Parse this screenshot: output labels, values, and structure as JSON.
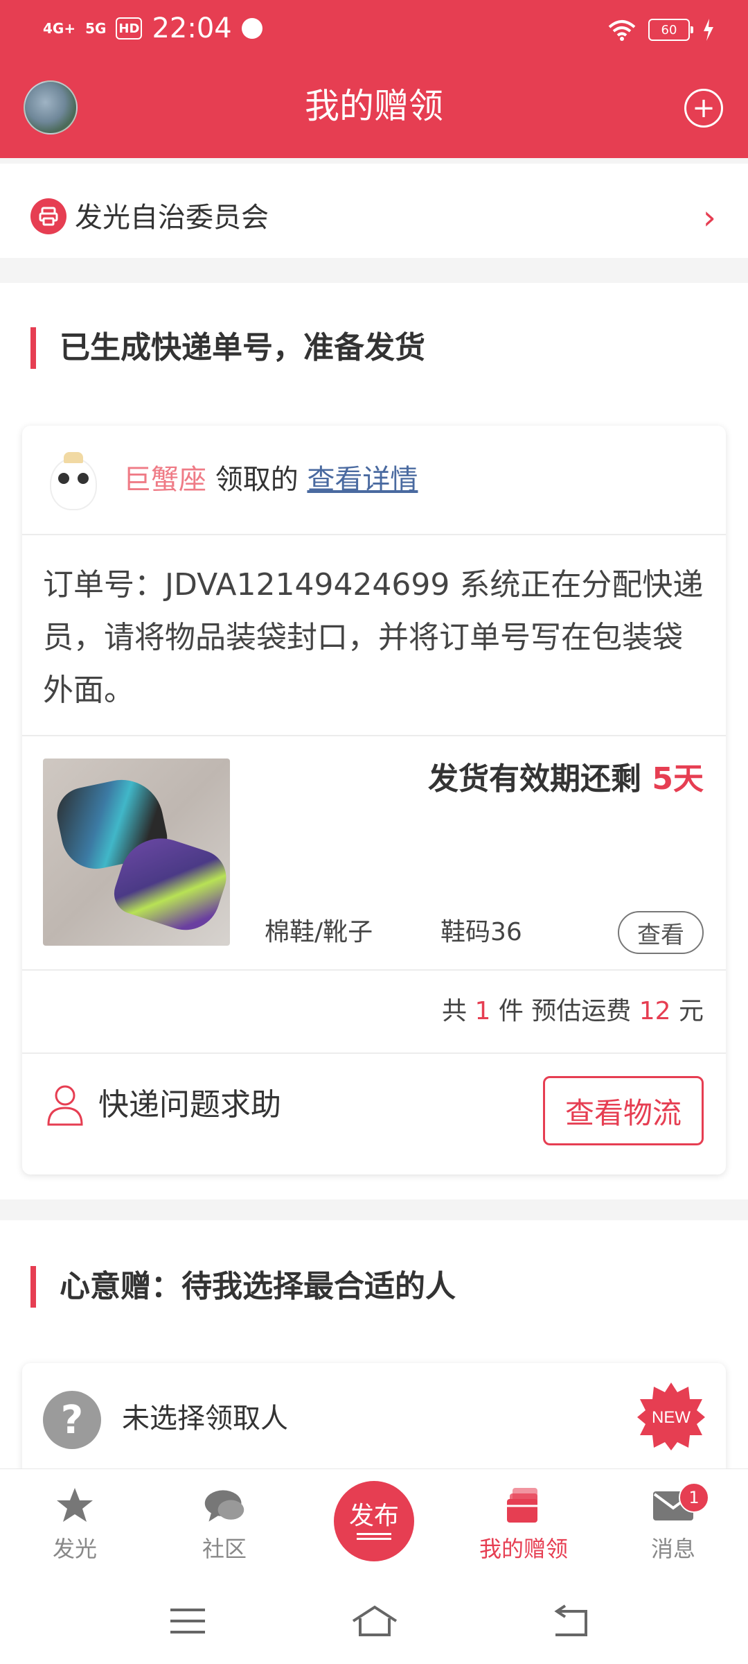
{
  "status_bar": {
    "signal1": "4G+",
    "signal2": "5G",
    "hd": "HD",
    "time": "22:04",
    "battery": "60"
  },
  "header": {
    "title": "我的赠领"
  },
  "group": {
    "name": "发光自治委员会"
  },
  "section_shipping": {
    "title": "已生成快递单号，准备发货",
    "claimer_name": "巨蟹座",
    "claimer_text": "领取的",
    "detail_link": "查看详情",
    "order_message": "订单号：JDVA12149424699 系统正在分配快递员，请将物品装袋封口，并将订单号写在包装袋外面。",
    "validity_prefix": "发货有效期还剩",
    "validity_days": "5天",
    "item_category": "棉鞋/靴子",
    "item_size": "鞋码36",
    "view_button": "查看",
    "summary_prefix": "共",
    "summary_count": "1",
    "summary_mid": "件 预估运费",
    "summary_fee": "12",
    "summary_suffix": "元",
    "help_text": "快递问题求助",
    "logistics_button": "查看物流"
  },
  "section_heart": {
    "title": "心意赠：待我选择最合适的人",
    "no_pick_text": "未选择领取人",
    "new_badge": "NEW"
  },
  "bottom_nav": {
    "items": [
      {
        "label": "发光",
        "icon": "star-icon"
      },
      {
        "label": "社区",
        "icon": "chat-icon"
      },
      {
        "label": "发布",
        "icon": "publish-icon"
      },
      {
        "label": "我的赠领",
        "icon": "gift-cards-icon"
      },
      {
        "label": "消息",
        "icon": "mail-icon"
      }
    ],
    "message_badge": "1"
  },
  "colors": {
    "brand": "#e63e52",
    "pink_name": "#ef7b86",
    "link": "#4a6aa0"
  }
}
